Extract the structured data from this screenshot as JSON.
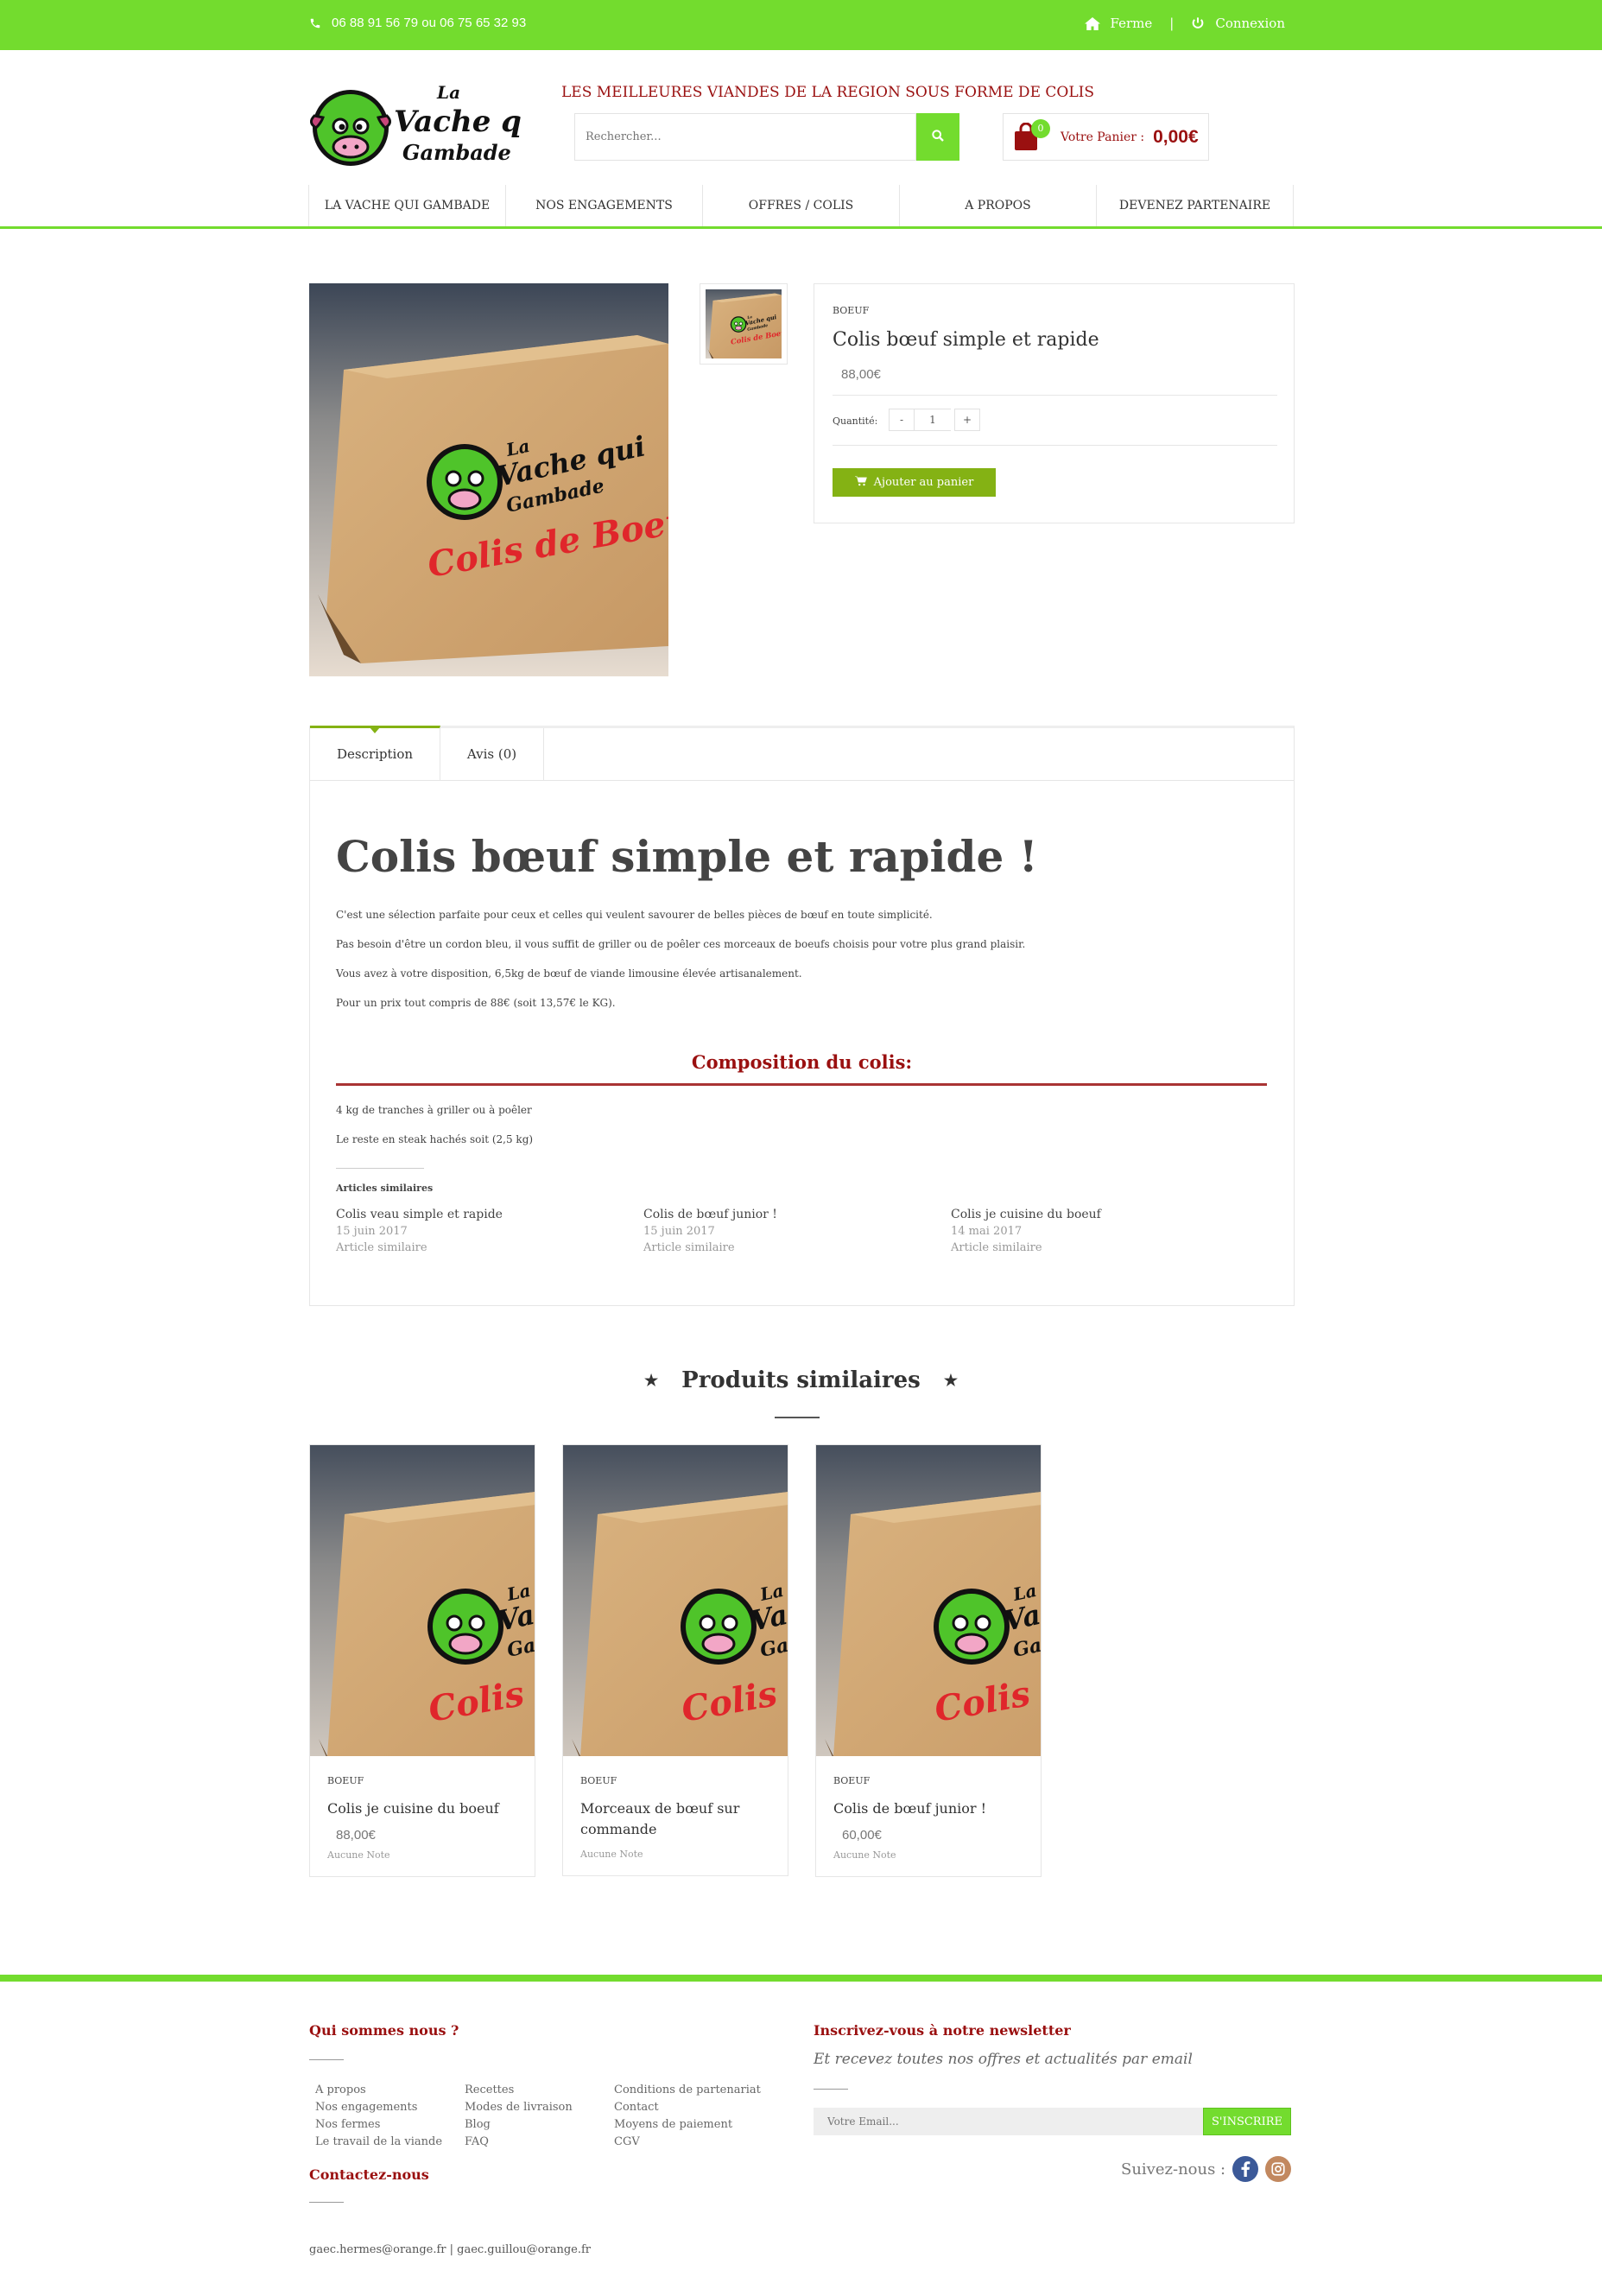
{
  "topbar": {
    "phone": "06 88 91 56 79 ou 06 75 65 32 93",
    "home_label": "Ferme",
    "separator": "|",
    "login_label": "Connexion",
    "accent": "#73dc2e"
  },
  "header": {
    "tagline": "LES MEILLEURES VIANDES DE LA REGION SOUS FORME DE COLIS",
    "search_placeholder": "Rechercher...",
    "cart_count": "0",
    "cart_label": "Votre Panier :",
    "cart_value": "0,00€",
    "brand_color": "#9a1010"
  },
  "logo": {
    "line1": "La",
    "line2": "Vache qui",
    "line3": "Gambade"
  },
  "nav": {
    "items": [
      "LA VACHE QUI GAMBADE",
      "NOS ENGAGEMENTS",
      "OFFRES / COLIS",
      "A PROPOS",
      "DEVENEZ PARTENAIRE"
    ]
  },
  "box_label": "Colis de Boeuf",
  "product": {
    "category": "BOEUF",
    "title": "Colis bœuf simple et rapide",
    "price": "88,00€",
    "qty_label": "Quantité:",
    "qty_minus": "-",
    "qty_value": "1",
    "qty_plus": "+",
    "add_label": "Ajouter au panier",
    "button_color": "#84b214"
  },
  "tabs": {
    "description": "Description",
    "reviews": "Avis (0)"
  },
  "description": {
    "heading": "Colis bœuf simple et rapide !",
    "p1": "C'est une sélection parfaite pour ceux et celles qui veulent savourer de belles pièces de bœuf en toute simplicité.",
    "p2": "Pas besoin d'être un cordon bleu, il vous suffit de griller ou de poêler ces morceaux de boeufs choisis pour votre plus grand plaisir.",
    "p3": "Vous avez à votre disposition, 6,5kg de bœuf de viande limousine élevée artisanalement.",
    "p4": "Pour un prix tout compris de 88€ (soit 13,57€ le KG).",
    "composition_title": "Composition du colis:",
    "c1": "4 kg de tranches à griller ou à poêler",
    "c2": "Le reste en steak hachés soit (2,5 kg)",
    "related_heading": "Articles similaires",
    "related": [
      {
        "title": "Colis veau simple et rapide",
        "date": "15 juin 2017",
        "sub": "Article similaire"
      },
      {
        "title": "Colis de bœuf junior !",
        "date": "15 juin 2017",
        "sub": "Article similaire"
      },
      {
        "title": "Colis je cuisine du boeuf",
        "date": "14 mai 2017",
        "sub": "Article similaire"
      }
    ]
  },
  "similar": {
    "heading": "Produits similaires",
    "star": "★",
    "cards": [
      {
        "category": "BOEUF",
        "name": "Colis je cuisine du boeuf",
        "price": "88,00€",
        "note": "Aucune Note"
      },
      {
        "category": "BOEUF",
        "name": "Morceaux de bœuf sur commande",
        "price": "",
        "note": "Aucune Note"
      },
      {
        "category": "BOEUF",
        "name": "Colis de bœuf junior !",
        "price": "60,00€",
        "note": "Aucune Note"
      }
    ]
  },
  "footer": {
    "about_heading": "Qui sommes nous ?",
    "col1": [
      "A propos",
      "Nos engagements",
      "Nos fermes",
      "Le travail de la viande"
    ],
    "col2": [
      "Recettes",
      "Modes de livraison",
      "Blog",
      "FAQ"
    ],
    "col3": [
      "Conditions de partenariat",
      "Contact",
      "Moyens de paiement",
      "CGV"
    ],
    "contact_heading": "Contactez-nous",
    "emails": "gaec.hermes@orange.fr | gaec.guillou@orange.fr",
    "newsletter_heading": "Inscrivez-vous à notre newsletter",
    "newsletter_sub": "Et recevez toutes nos offres et actualités par email",
    "email_placeholder": "Votre Email...",
    "subscribe_label": "S'INSCRIRE",
    "follow_label": "Suivez-nous :"
  }
}
